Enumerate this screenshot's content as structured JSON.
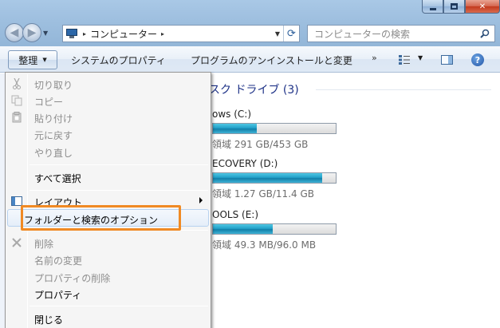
{
  "address": {
    "path_label": "コンピューター",
    "separator": "▸"
  },
  "search": {
    "placeholder": "コンピューターの検索"
  },
  "toolbar": {
    "organize_label": "整理",
    "system_properties_label": "システムのプロパティ",
    "uninstall_label": "プログラムのアンインストールと変更",
    "more_label": "»",
    "help_label": "?"
  },
  "content": {
    "section_header": "スク ドライブ (3)",
    "drives": [
      {
        "name": "ows (C:)",
        "free_text": "領域 291 GB/453 GB",
        "used_fraction": 0.36
      },
      {
        "name": "ECOVERY (D:)",
        "free_text": "領域 1.27 GB/11.4 GB",
        "used_fraction": 0.89
      },
      {
        "name": "OOLS (E:)",
        "free_text": "領域 49.3 MB/96.0 MB",
        "used_fraction": 0.49
      }
    ]
  },
  "menu": {
    "items": [
      {
        "label": "切り取り",
        "state": "disabled",
        "icon": "scissors-icon"
      },
      {
        "label": "コピー",
        "state": "disabled",
        "icon": "copy-icon"
      },
      {
        "label": "貼り付け",
        "state": "disabled",
        "icon": "paste-icon"
      },
      {
        "label": "元に戻す",
        "state": "disabled",
        "icon": ""
      },
      {
        "label": "やり直し",
        "state": "disabled",
        "icon": ""
      },
      {
        "label": "すべて選択",
        "state": "enabled",
        "icon": ""
      },
      {
        "label": "レイアウト",
        "state": "enabled",
        "icon": "layout-icon",
        "submenu": true
      },
      {
        "label": "フォルダーと検索のオプション",
        "state": "enabled",
        "icon": "",
        "highlighted": true
      },
      {
        "label": "削除",
        "state": "disabled",
        "icon": "delete-x-icon"
      },
      {
        "label": "名前の変更",
        "state": "disabled",
        "icon": ""
      },
      {
        "label": "プロパティの削除",
        "state": "disabled",
        "icon": ""
      },
      {
        "label": "プロパティ",
        "state": "enabled",
        "icon": ""
      },
      {
        "label": "閉じる",
        "state": "enabled",
        "icon": ""
      }
    ]
  },
  "colors": {
    "highlight_box": "#f08a24",
    "section_header": "#1e3287",
    "drive_fill": "#22a0c9"
  }
}
